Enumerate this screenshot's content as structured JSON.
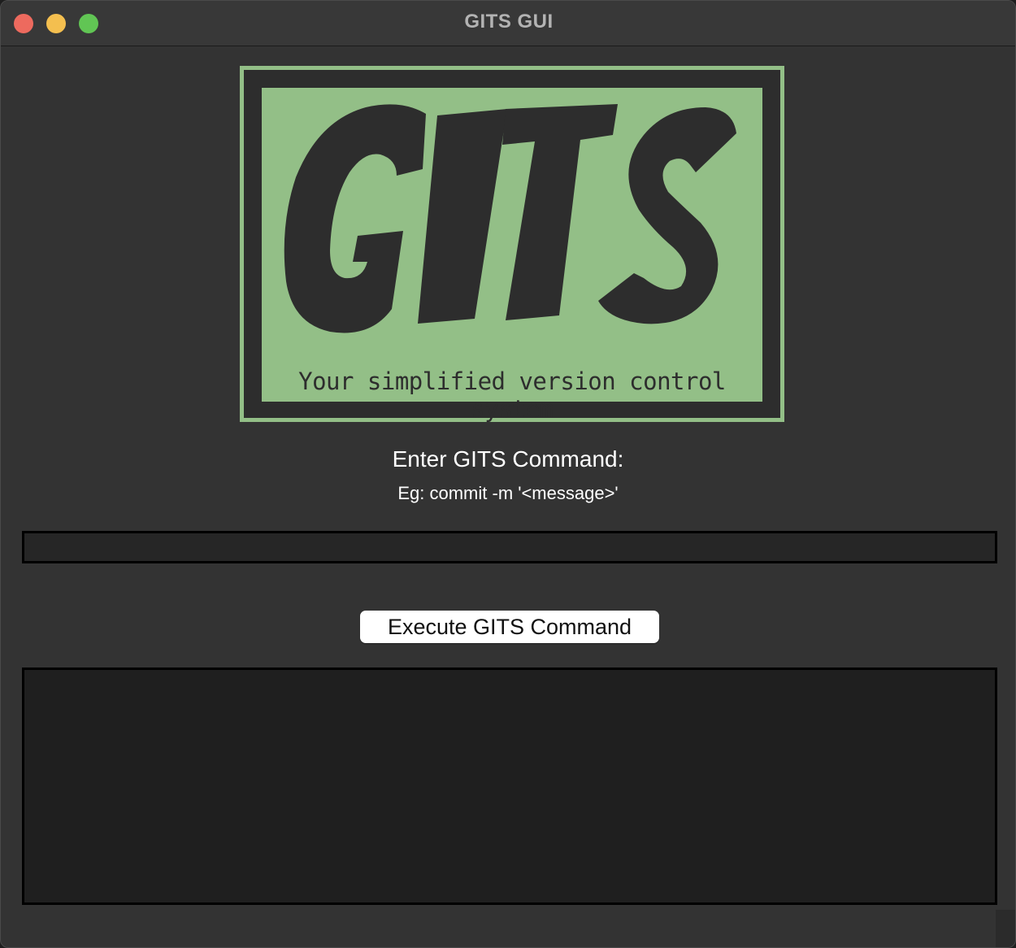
{
  "window": {
    "title": "GITS GUI",
    "traffic_lights": {
      "close_color": "#ed6a5e",
      "minimize_color": "#f4bf4f",
      "maximize_color": "#61c554"
    }
  },
  "logo": {
    "wordmark": "GITS",
    "tagline": "Your simplified version control system",
    "colors": {
      "background": "#93bf87",
      "ink": "#2d2d2d"
    }
  },
  "form": {
    "prompt_label": "Enter GITS Command:",
    "example_text": "Eg: commit -m '<message>'",
    "command_input": {
      "value": "",
      "placeholder": ""
    },
    "execute_button_label": "Execute GITS Command",
    "output_text": ""
  }
}
